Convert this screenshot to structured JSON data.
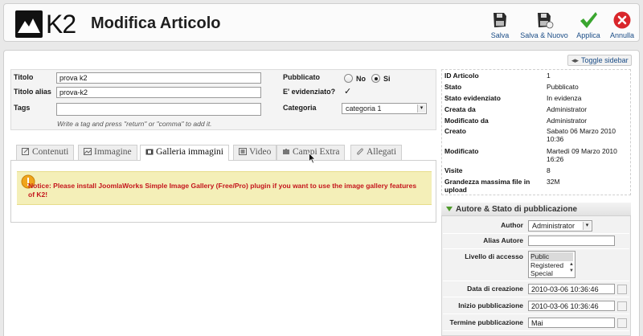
{
  "header": {
    "logo_text": "K2",
    "title": "Modifica Articolo",
    "toolbar": {
      "save": "Salva",
      "save_new": "Salva & Nuovo",
      "apply": "Applica",
      "cancel": "Annulla"
    }
  },
  "toggle_sidebar": "Toggle sidebar",
  "form": {
    "title_label": "Titolo",
    "title_value": "prova k2",
    "alias_label": "Titolo alias",
    "alias_value": "prova-k2",
    "tags_label": "Tags",
    "tags_value": "",
    "tags_hint": "Write a tag and press \"return\" or \"comma\" to add it.",
    "published_label": "Pubblicato",
    "published_no": "No",
    "published_yes": "Si",
    "published_selected": "Si",
    "featured_label": "E' evidenziato?",
    "featured_checked": true,
    "category_label": "Categoria",
    "category_value": "categoria 1"
  },
  "tabs": [
    {
      "label": "Contenuti",
      "icon": "document-edit-icon",
      "active": false
    },
    {
      "label": "Immagine",
      "icon": "image-icon",
      "active": false
    },
    {
      "label": "Galleria immagini",
      "icon": "gallery-icon",
      "active": true
    },
    {
      "label": "Video",
      "icon": "video-icon",
      "active": false
    },
    {
      "label": "Campi Extra",
      "icon": "puzzle-icon",
      "active": false
    },
    {
      "label": "Allegati",
      "icon": "paperclip-icon",
      "active": false
    }
  ],
  "notice": "Notice: Please install JoomlaWorks Simple Image Gallery (Free/Pro) plugin if you want to use the image gallery features of K2!",
  "info": [
    {
      "label": "ID Articolo",
      "value": "1"
    },
    {
      "label": "Stato",
      "value": "Pubblicato"
    },
    {
      "label": "Stato evidenziato",
      "value": "In evidenza"
    },
    {
      "label": "Creata da",
      "value": "Administrator"
    },
    {
      "label": "Modificato da",
      "value": "Administrator"
    },
    {
      "label": "Creato",
      "value": "Sabato 06 Marzo 2010 10:36"
    },
    {
      "label": "Modificato",
      "value": "Martedì 09 Marzo 2010 16:26"
    },
    {
      "label": "Visite",
      "value": "8"
    },
    {
      "label": "Grandezza massima file in upload",
      "value": "32M"
    }
  ],
  "author_section": {
    "title": "Autore & Stato di pubblicazione",
    "author_label": "Author",
    "author_value": "Administrator",
    "alias_label": "Alias Autore",
    "alias_value": "",
    "access_label": "Livello di accesso",
    "access_options": [
      "Public",
      "Registered",
      "Special"
    ],
    "access_selected": "Public",
    "created_label": "Data di creazione",
    "created_value": "2010-03-06 10:36:46",
    "publish_up_label": "Inizio pubblicazione",
    "publish_up_value": "2010-03-06 10:36:46",
    "publish_down_label": "Termine pubblicazione",
    "publish_down_value": "Mai"
  },
  "colors": {
    "notice_bg": "#f4efb8",
    "notice_text": "#c4151c",
    "link": "#1a4c86",
    "accent_green": "#4e9a2a"
  }
}
